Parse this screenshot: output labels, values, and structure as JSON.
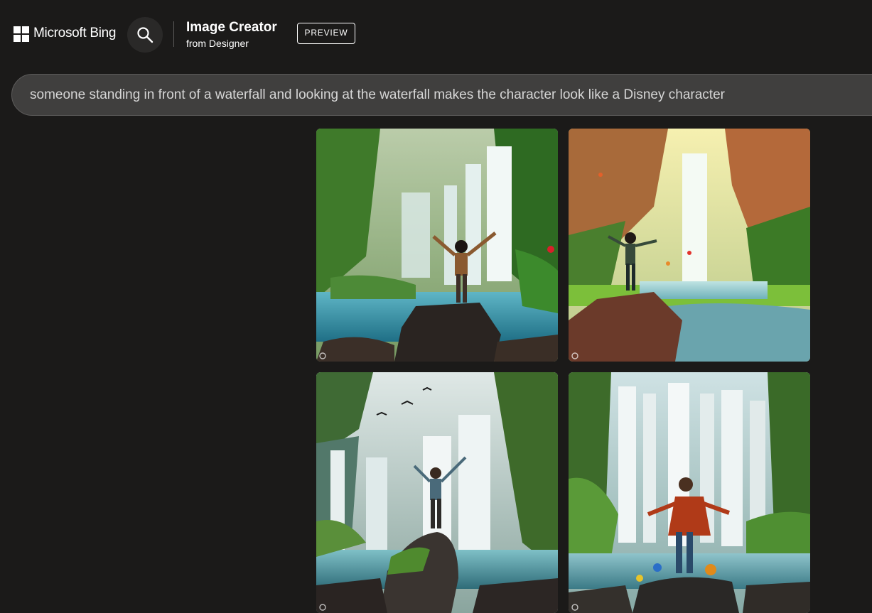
{
  "header": {
    "brand": "Microsoft Bing",
    "title": "Image Creator",
    "subtitle": "from Designer",
    "badge": "PREVIEW",
    "icons": [
      "microsoft-logo",
      "search-icon"
    ]
  },
  "prompt": {
    "value": "someone standing in front of a waterfall and looking at the waterfall makes the character look like a Disney character"
  },
  "images": [
    {
      "subject": "person with raised arms on rock before tropical waterfall"
    },
    {
      "subject": "person on boulder facing waterfall in canyon"
    },
    {
      "subject": "person with raised arms on mossy rock before tall waterfalls"
    },
    {
      "subject": "boy in red jacket on rock facing wide waterfall with birds"
    }
  ],
  "colors": {
    "background": "#1b1a19",
    "prompt_bg": "#403f3e",
    "text": "#ffffff"
  }
}
